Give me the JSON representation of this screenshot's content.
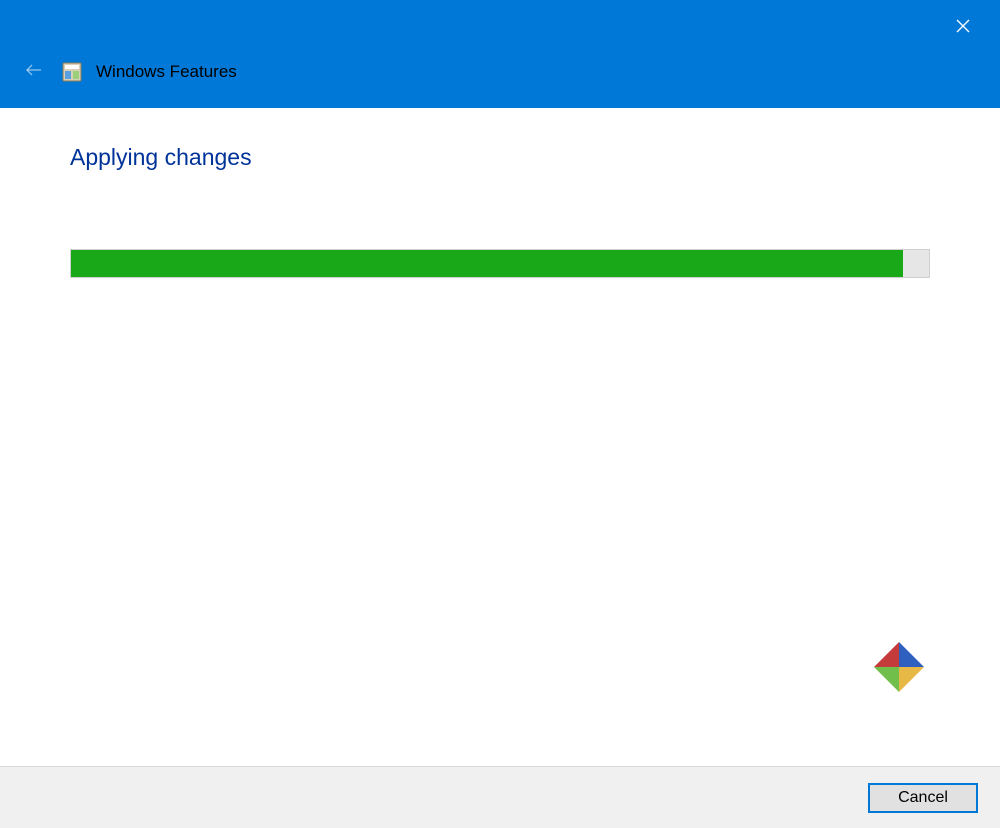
{
  "window": {
    "title": "Windows Features"
  },
  "colors": {
    "titlebar_bg": "#0078d7",
    "heading_text": "#003399",
    "progress_fill": "#18a818",
    "progress_track": "#e6e6e6"
  },
  "main": {
    "heading": "Applying changes",
    "progress_percent": 97
  },
  "footer": {
    "cancel_label": "Cancel"
  }
}
